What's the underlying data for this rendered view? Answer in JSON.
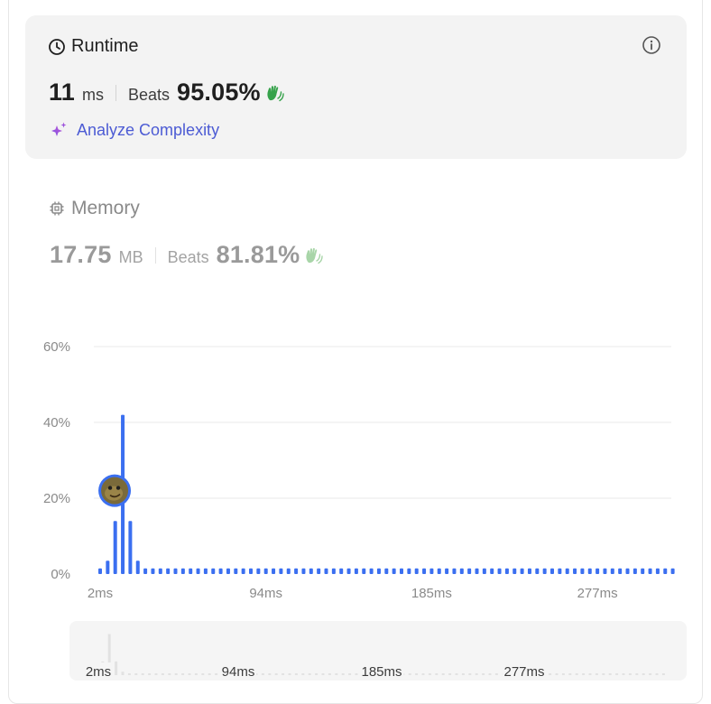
{
  "runtime": {
    "title": "Runtime",
    "value": "11",
    "unit": "ms",
    "beats_label": "Beats",
    "beats_value": "95.05%",
    "analyze_label": "Analyze Complexity",
    "title_icon": "clock-icon",
    "info_icon": "info-icon",
    "wave_icon": "clapping-hands-icon",
    "analyze_icon": "sparkle-icon"
  },
  "memory": {
    "title": "Memory",
    "value": "17.75",
    "unit": "MB",
    "beats_label": "Beats",
    "beats_value": "81.81%",
    "title_icon": "chip-icon"
  },
  "colors": {
    "accent": "#3b6ff0",
    "analyze": "#4c5bd4",
    "grid": "#e8e8e8",
    "muted": "#8a8a8a",
    "wave_green": "#36a24b"
  },
  "chart_data": {
    "type": "bar",
    "ylabel_ticks": [
      "0%",
      "20%",
      "40%",
      "60%"
    ],
    "ylim": [
      0,
      60
    ],
    "x_ticks": [
      "2ms",
      "94ms",
      "185ms",
      "277ms"
    ],
    "values": [
      1.5,
      3.5,
      14,
      42,
      14,
      3.5,
      1.5,
      1.5,
      1.5,
      1.5,
      1.5,
      1.5,
      1.5,
      1.5,
      1.5,
      1.5,
      1.5,
      1.5,
      1.5,
      1.5,
      1.5,
      1.5,
      1.5,
      1.5,
      1.5,
      1.5,
      1.5,
      1.5,
      1.5,
      1.5,
      1.5,
      1.5,
      1.5,
      1.5,
      1.5,
      1.5,
      1.5,
      1.5,
      1.5,
      1.5,
      1.5,
      1.5,
      1.5,
      1.5,
      1.5,
      1.5,
      1.5,
      1.5,
      1.5,
      1.5,
      1.5,
      1.5,
      1.5,
      1.5,
      1.5,
      1.5,
      1.5,
      1.5,
      1.5,
      1.5,
      1.5,
      1.5,
      1.5,
      1.5,
      1.5,
      1.5,
      1.5,
      1.5,
      1.5,
      1.5,
      1.5,
      1.5,
      1.5,
      1.5,
      1.5,
      1.5,
      1.5
    ],
    "highlight_index": 3,
    "highlight_value": 22,
    "grid": true,
    "brush_x_ticks": [
      "2ms",
      "94ms",
      "185ms",
      "277ms"
    ]
  }
}
